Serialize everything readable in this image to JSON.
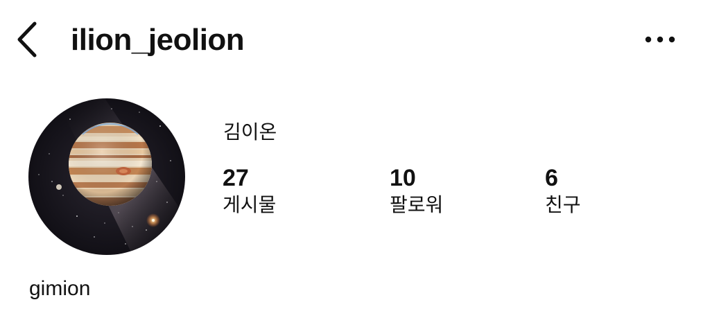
{
  "header": {
    "username": "ilion_jeolion",
    "back_icon": "chevron-left-icon",
    "more_icon": "more-horizontal-icon"
  },
  "profile": {
    "avatar_description_icon": "jupiter-avatar",
    "display_name": "김이온",
    "bio": "gimion"
  },
  "stats": [
    {
      "value": "27",
      "label": "게시물"
    },
    {
      "value": "10",
      "label": "팔로워"
    },
    {
      "value": "6",
      "label": "친구"
    }
  ],
  "colors": {
    "text": "#111111",
    "background": "#ffffff"
  }
}
